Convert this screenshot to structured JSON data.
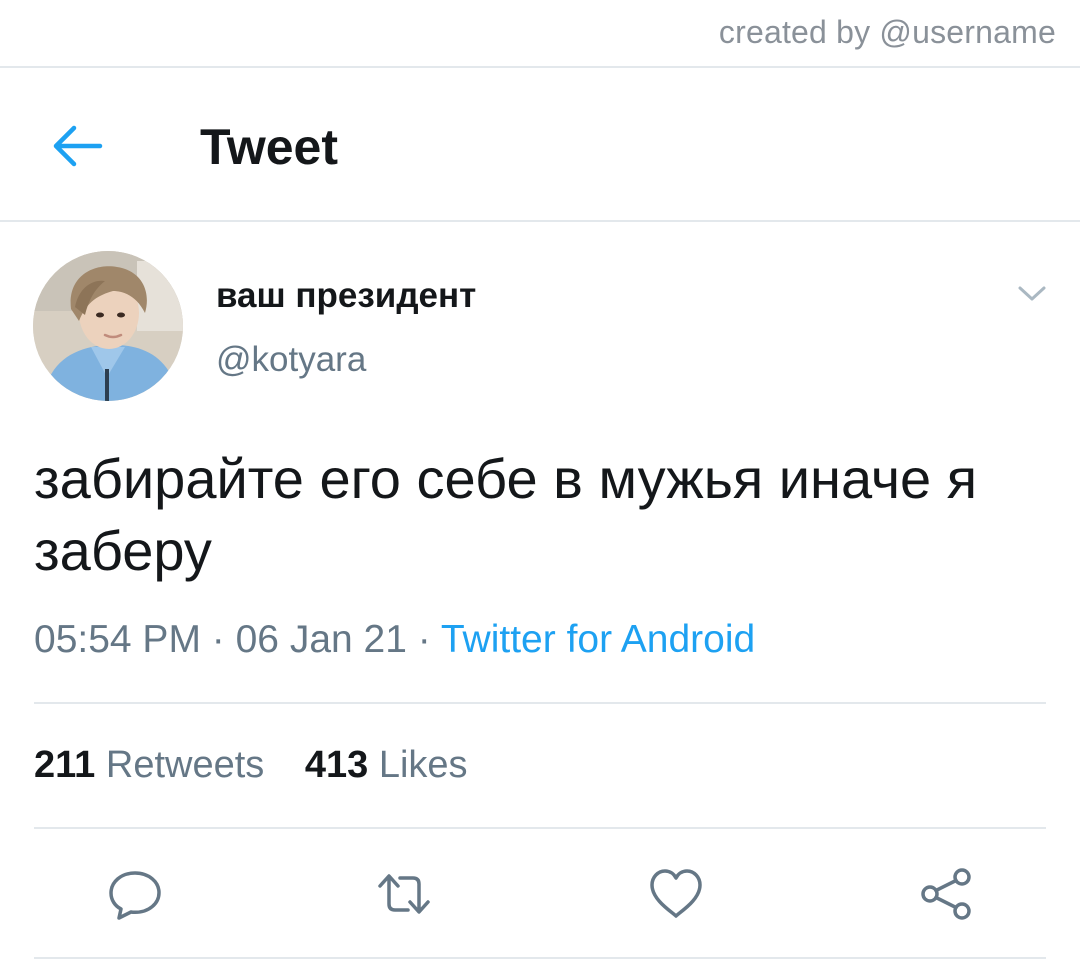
{
  "watermark": {
    "text": "created by @username"
  },
  "header": {
    "title": "Tweet",
    "back_icon": "arrow-left-icon"
  },
  "author": {
    "display_name": "ваш президент",
    "handle": "@kotyara",
    "avatar": "avatar-photo"
  },
  "tweet": {
    "text": "забирайте его себе в мужья иначе я заберу",
    "time": "05:54 PM",
    "date": "06 Jan 21",
    "separator": " · ",
    "source": "Twitter for Android"
  },
  "stats": {
    "retweets_count": "211",
    "retweets_label": "Retweets",
    "likes_count": "413",
    "likes_label": "Likes"
  },
  "actions": {
    "icons": [
      "reply-icon",
      "retweet-icon",
      "like-icon",
      "share-icon"
    ]
  },
  "colors": {
    "accent": "#1da1f2",
    "text_primary": "#14171a",
    "text_secondary": "#657786",
    "divider": "#e3e8ec",
    "icon": "#657786"
  }
}
